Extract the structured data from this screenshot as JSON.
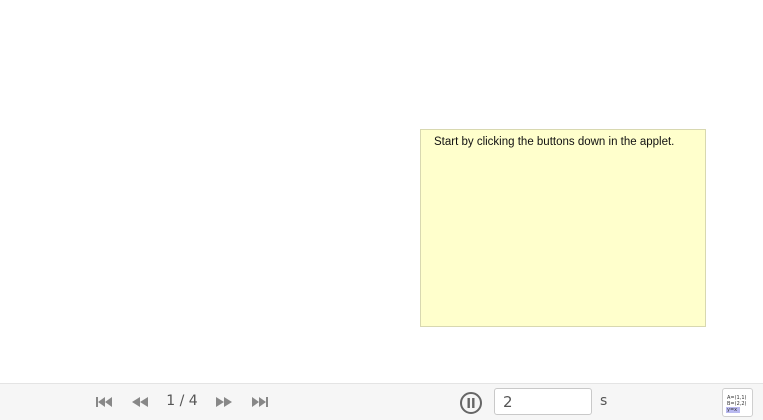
{
  "note": {
    "text": "Start by clicking the buttons down in the applet."
  },
  "toolbar": {
    "first_icon": "skip-to-start-icon",
    "prev_icon": "step-back-icon",
    "page_indicator": "1 / 4",
    "next_icon": "step-forward-icon",
    "last_icon": "skip-to-end-icon",
    "play_icon": "pause-circle-icon",
    "speed_value": "2",
    "speed_unit": "s",
    "algebra_icon": "algebra-view-icon",
    "algebra_lines": [
      "A=(1,1)",
      "B=(2,2)",
      "y=x"
    ]
  },
  "colors": {
    "note_background": "#ffffcc",
    "toolbar_background": "#f6f6f6",
    "icon_gray": "#888888"
  }
}
